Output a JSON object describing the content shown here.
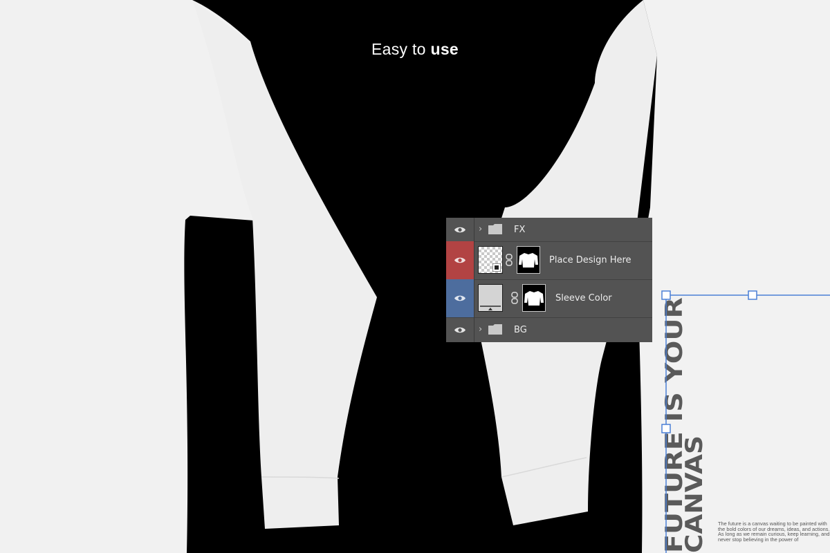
{
  "headline": {
    "text": "Easy to",
    "bold": "use"
  },
  "layers_panel": {
    "rows": [
      {
        "name": "FX",
        "type": "group"
      },
      {
        "name": "Place Design Here",
        "type": "smart-object"
      },
      {
        "name": "Sleeve Color",
        "type": "fill"
      },
      {
        "name": "BG",
        "type": "group"
      }
    ],
    "colors": {
      "panel": "#535353",
      "selected_red": "#b24343",
      "selected_blue": "#4d6d9e"
    }
  },
  "canvas_design": {
    "vertical_line_1": "FUTURE IS YOUR",
    "vertical_line_2": "CANVAS",
    "body_text": "The future is a canvas waiting to be painted with the bold colors of our dreams, ideas, and actions. As long as we remain curious, keep learning, and never stop believing in the power of"
  },
  "colors": {
    "background": "#000000",
    "shirt": "#f0f0f0",
    "selection": "#4a7fd6"
  }
}
